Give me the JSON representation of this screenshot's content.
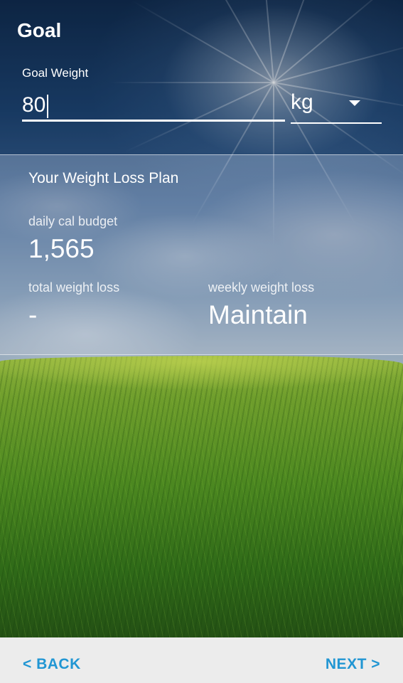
{
  "header": {
    "title": "Goal"
  },
  "goal_weight": {
    "label": "Goal Weight",
    "value": "80",
    "unit": "kg"
  },
  "plan": {
    "title": "Your Weight Loss Plan",
    "daily_budget": {
      "label": "daily cal budget",
      "value": "1,565"
    },
    "total_loss": {
      "label": "total weight loss",
      "value": "-"
    },
    "weekly_loss": {
      "label": "weekly weight loss",
      "value": "Maintain"
    }
  },
  "footer": {
    "back_label": "< BACK",
    "next_label": "NEXT >"
  },
  "colors": {
    "accent": "#2196d3",
    "footer_bg": "#ececec",
    "text": "#ffffff"
  },
  "icons": {
    "unit_dropdown": "chevron-down-icon"
  }
}
